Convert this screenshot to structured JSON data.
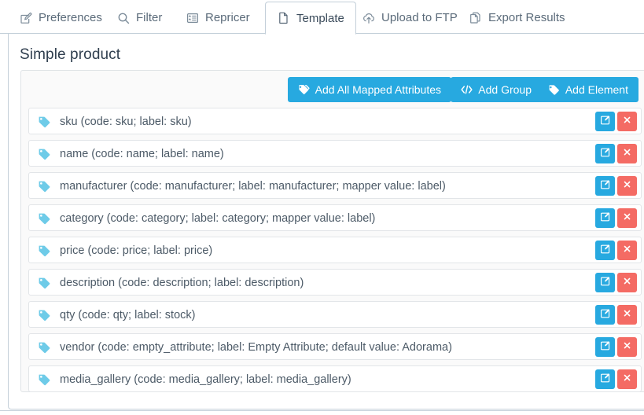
{
  "tabs": [
    {
      "label": "Preferences",
      "icon": "edit-square-icon",
      "active": false
    },
    {
      "label": "Filter",
      "icon": "search-icon",
      "active": false
    },
    {
      "label": "Repricer",
      "icon": "list-grid-icon",
      "active": false
    },
    {
      "label": "Template",
      "icon": "file-icon",
      "active": true
    },
    {
      "label": "Upload to FTP",
      "icon": "cloud-upload-icon",
      "active": false
    },
    {
      "label": "Export Results",
      "icon": "copy-files-icon",
      "active": false
    }
  ],
  "page": {
    "title": "Simple product"
  },
  "toolbar": {
    "add_all_label": "Add All Mapped Attributes",
    "add_all_icon": "tags-icon",
    "add_group_label": "Add Group",
    "add_group_icon": "code-icon",
    "add_element_label": "Add Element",
    "add_element_icon": "tag-icon"
  },
  "row_actions": {
    "edit_icon": "edit-square-icon",
    "edit_title": "Edit",
    "delete_icon": "close-x-icon",
    "delete_title": "Delete"
  },
  "elements": [
    {
      "label": "sku (code: sku; label: sku)"
    },
    {
      "label": "name (code: name; label: name)"
    },
    {
      "label": "manufacturer (code: manufacturer; label: manufacturer; mapper value: label)"
    },
    {
      "label": "category (code: category; label: category; mapper value: label)"
    },
    {
      "label": "price (code: price; label: price)"
    },
    {
      "label": "description (code: description; label: description)"
    },
    {
      "label": "qty (code: qty; label: stock)"
    },
    {
      "label": "vendor (code: empty_attribute; label: Empty Attribute; default value: Adorama)"
    },
    {
      "label": "media_gallery (code: media_gallery; label: media_gallery)"
    }
  ],
  "colors": {
    "accent_blue": "#27a9e0",
    "danger_red": "#f46b64",
    "tag_cyan": "#6ecbe8",
    "text": "#4c5a67",
    "border": "#c3cfd9",
    "panel_bg": "#fafafa"
  }
}
